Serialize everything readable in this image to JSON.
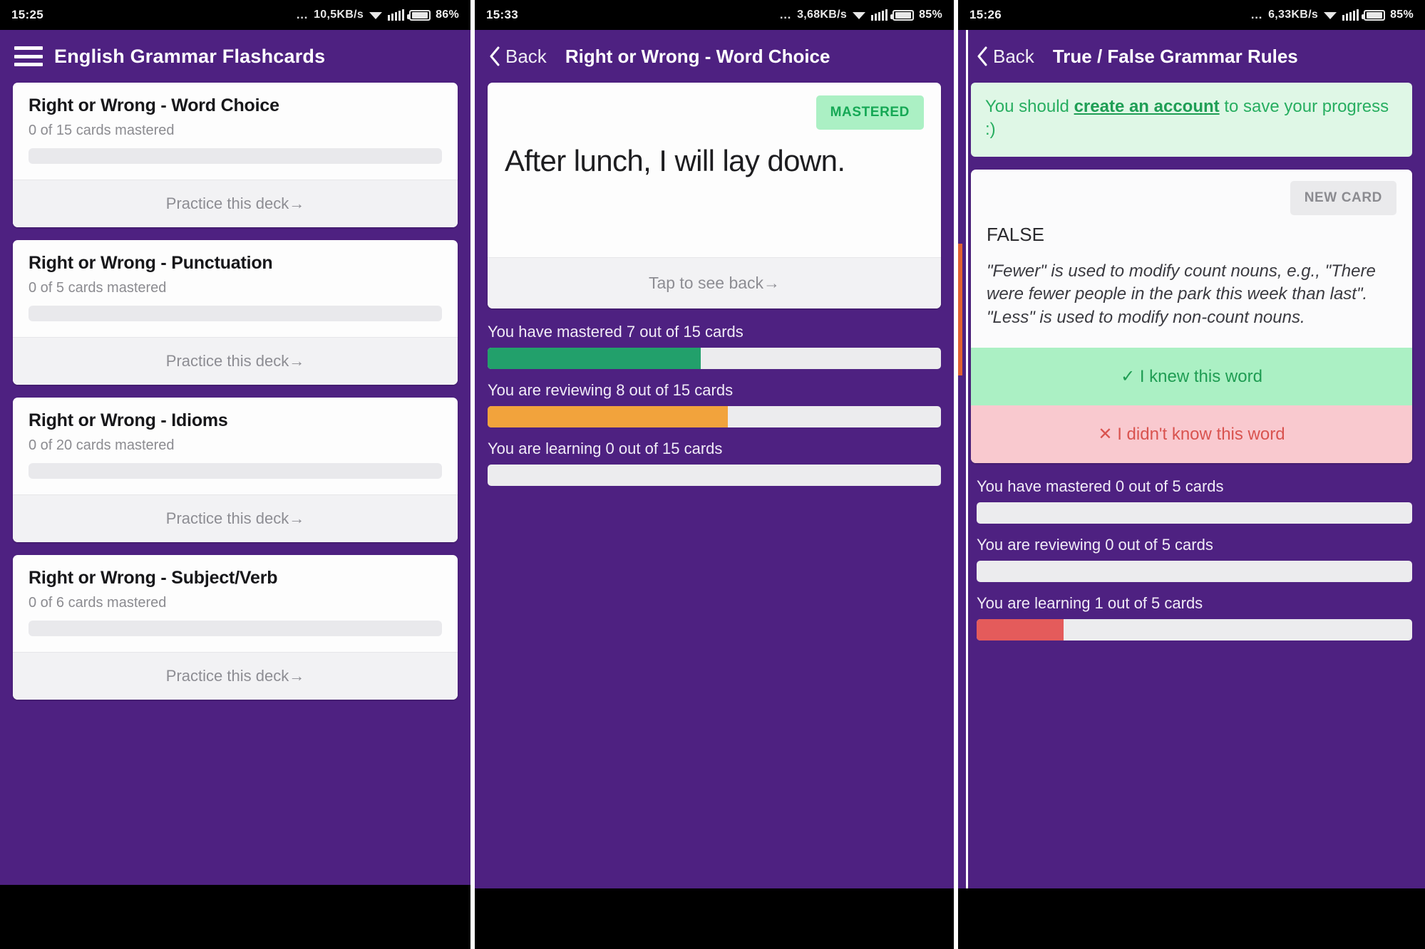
{
  "panels": [
    {
      "status": {
        "time": "15:25",
        "dots": "…",
        "rate": "10,5KB/s",
        "battery": "86%",
        "wifi_icon": "wifi-icon",
        "signal_icon": "signal-bars-icon",
        "battery_icon": "battery-icon"
      },
      "header": {
        "menu_icon": "hamburger-menu-icon",
        "title": "English Grammar Flashcards"
      },
      "decks": [
        {
          "title": "Right or Wrong - Word Choice",
          "subtitle": "0 of 15 cards mastered",
          "progress_pct": 0,
          "action": "Practice this deck",
          "arrow": "→"
        },
        {
          "title": "Right or Wrong - Punctuation",
          "subtitle": "0 of 5 cards mastered",
          "progress_pct": 0,
          "action": "Practice this deck",
          "arrow": "→"
        },
        {
          "title": "Right or Wrong - Idioms",
          "subtitle": "0 of 20 cards mastered",
          "progress_pct": 0,
          "action": "Practice this deck",
          "arrow": "→"
        },
        {
          "title": "Right or Wrong - Subject/Verb",
          "subtitle": "0 of 6 cards mastered",
          "progress_pct": 0,
          "action": "Practice this deck",
          "arrow": "→"
        }
      ]
    },
    {
      "status": {
        "time": "15:33",
        "dots": "…",
        "rate": "3,68KB/s",
        "battery": "85%",
        "wifi_icon": "wifi-icon",
        "signal_icon": "signal-bars-icon",
        "battery_icon": "battery-icon"
      },
      "header": {
        "back_icon": "chevron-left-icon",
        "back_label": "Back",
        "title": "Right or Wrong - Word Choice"
      },
      "flashcard": {
        "badge": "MASTERED",
        "front_text": "After lunch, I will lay down.",
        "footer": "Tap to see back",
        "footer_arrow": "→"
      },
      "progress": [
        {
          "label": "You have mastered 7 out of 15 cards",
          "pct": 47,
          "color": "#22a06b"
        },
        {
          "label": "You are reviewing 8 out of 15 cards",
          "pct": 53,
          "color": "#f2a33c"
        },
        {
          "label": "You are learning 0 out of 15 cards",
          "pct": 0,
          "color": "#e45b5b"
        }
      ]
    },
    {
      "status": {
        "time": "15:26",
        "dots": "…",
        "rate": "6,33KB/s",
        "battery": "85%",
        "wifi_icon": "wifi-icon",
        "signal_icon": "signal-bars-icon",
        "battery_icon": "battery-icon"
      },
      "header": {
        "back_icon": "chevron-left-icon",
        "back_label": "Back",
        "title": "True / False Grammar Rules"
      },
      "notice": {
        "prefix": "You should ",
        "link": "create an account",
        "suffix": " to save your progress :)"
      },
      "answer_card": {
        "badge": "NEW CARD",
        "verdict": "FALSE",
        "explanation": "\"Fewer\" is used to modify count nouns, e.g., \"There were fewer people in the park this week than last\". \"Less\" is used to modify non-count nouns.",
        "knew_label": "I knew this word",
        "knew_icon": "check-icon",
        "didnt_label": "I didn't know this word",
        "didnt_icon": "cross-icon"
      },
      "progress": [
        {
          "label": "You have mastered 0 out of 5 cards",
          "pct": 0,
          "color": "#22a06b"
        },
        {
          "label": "You are reviewing 0 out of 5 cards",
          "pct": 0,
          "color": "#f2a33c"
        },
        {
          "label": "You are learning 1 out of 5 cards",
          "pct": 20,
          "color": "#e45b5b"
        }
      ]
    }
  ],
  "theme": {
    "purple": "#4e2181",
    "green": "#22a06b",
    "orange": "#f2a33c",
    "red": "#e45b5b",
    "card": "#fdfdfd"
  }
}
